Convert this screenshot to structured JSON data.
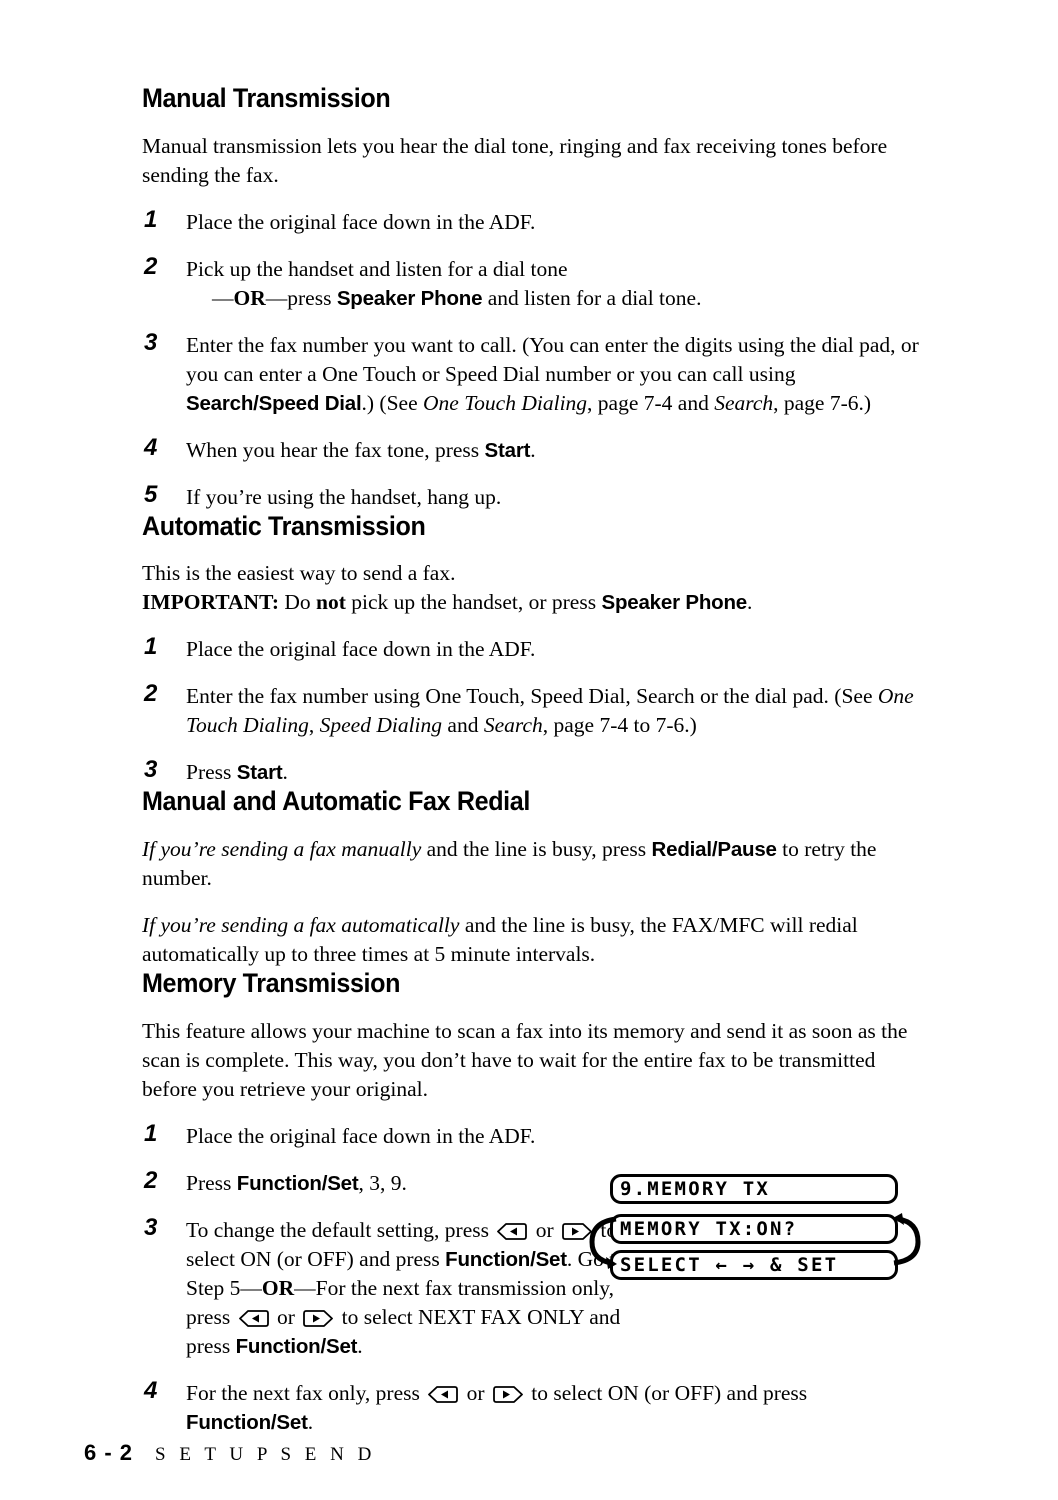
{
  "document": {
    "sections": [
      {
        "id": "manual-transmission",
        "heading": "Manual Transmission",
        "intro": "Manual transmission lets you hear the dial tone, ringing and fax receiving tones before sending the fax.",
        "steps": [
          {
            "num": "1",
            "text": "Place the original face down in the ADF."
          },
          {
            "num": "2",
            "line1": "Pick up the handset and listen for a dial tone",
            "or_prefix": "—",
            "or_word": "OR",
            "or_suffix": "—press ",
            "key": "Speaker Phone",
            "line2_tail": " and listen for a dial tone."
          },
          {
            "num": "3",
            "p1": "Enter the fax number you want to call. (You can enter the digits using the dial pad, or you can enter a One Touch or Speed Dial number or you can call using ",
            "key": "Search/Speed Dial",
            "p2": ".) (See ",
            "ital1": "One Touch Dialing",
            "p3": ", page 7-4 and ",
            "ital2": "Search",
            "p4": ", page 7-6.)"
          },
          {
            "num": "4",
            "p1": "When you hear the fax tone, press ",
            "key": "Start",
            "p2": "."
          },
          {
            "num": "5",
            "text": "If you’re using the handset, hang up."
          }
        ]
      },
      {
        "id": "automatic-transmission",
        "heading": "Automatic Transmission",
        "intro": "This is the easiest way to send a fax.",
        "important_label": "IMPORTANT:",
        "important_p1": "  Do ",
        "important_not": "not",
        "important_p2": " pick up the handset, or press ",
        "important_key": "Speaker Phone",
        "important_p3": ".",
        "steps": [
          {
            "num": "1",
            "text": "Place the original face down in the ADF."
          },
          {
            "num": "2",
            "p1": "Enter the fax number using One Touch, Speed Dial, Search or the dial pad. (See ",
            "ital1": "One Touch Dialing",
            "p2": ", ",
            "ital2": "Speed Dialing",
            "p3": " and ",
            "ital3": "Search",
            "p4": ", page 7-4 to 7-6.)"
          },
          {
            "num": "3",
            "p1": "Press ",
            "key": "Start",
            "p2": "."
          }
        ]
      },
      {
        "id": "fax-redial",
        "heading": "Manual and Automatic Fax Redial",
        "para1_ital": "If you’re sending a fax manually",
        "para1_p1": " and the line is busy, press ",
        "para1_key": "Redial/Pause",
        "para1_p2": " to retry the number.",
        "para2_ital": "If you’re sending a fax automatically",
        "para2_p1": " and the line is busy, the FAX/MFC will redial automatically up to three times at 5 minute intervals."
      },
      {
        "id": "memory-transmission",
        "heading": "Memory Transmission",
        "intro": "This feature allows your machine to scan a fax into its memory and send it as soon as the scan is complete. This way, you don’t have to wait for the entire fax to be transmitted before you retrieve your original.",
        "steps": [
          {
            "num": "1",
            "text": "Place the original face down in the ADF."
          },
          {
            "num": "2",
            "p1": "Press ",
            "key": "Function/Set",
            "p2": ", 3, 9."
          },
          {
            "num": "3",
            "p1": "To change the default setting, press ",
            "p2": " or ",
            "p3": " to select ON (or OFF) and press ",
            "key1": "Function/Set",
            "p4": ".  Go to Step 5—",
            "or_word": "OR",
            "p5": "—For the next fax transmission only, press ",
            "p6": " or ",
            "p7": " to select NEXT FAX ONLY and press ",
            "key2": "Function/Set",
            "p8": "."
          },
          {
            "num": "4",
            "p1": "For the next fax only, press ",
            "p2": " or ",
            "p3": " to select ON (or OFF) and press ",
            "key": "Function/Set",
            "p4": "."
          }
        ]
      }
    ]
  },
  "lcd_panel": {
    "line1": "9.MEMORY TX",
    "line2": "MEMORY TX:ON?",
    "line3": "SELECT ← → & SET",
    "left_arrow_icon": "loop-arrow-down-icon",
    "right_arrow_icon": "loop-arrow-up-icon"
  },
  "key_icons": {
    "left": "arrow-left-key-icon",
    "right": "arrow-right-key-icon"
  },
  "footer": {
    "page_number": "6 - 2",
    "chapter_title": "S E T U P   S E N D"
  },
  "colors": {
    "text": "#000000",
    "background": "#ffffff"
  }
}
